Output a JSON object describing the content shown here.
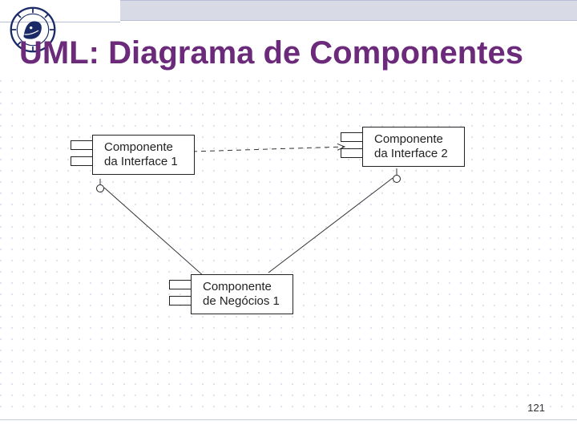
{
  "header": {
    "title": "UML: Diagrama de Componentes"
  },
  "page_number": "121",
  "components": {
    "c1": {
      "line1": "Componente",
      "line2": "da Interface 1"
    },
    "c2": {
      "line1": "Componente",
      "line2": "da Interface 2"
    },
    "c3": {
      "line1": "Componente",
      "line2": "de Negócios 1"
    }
  }
}
